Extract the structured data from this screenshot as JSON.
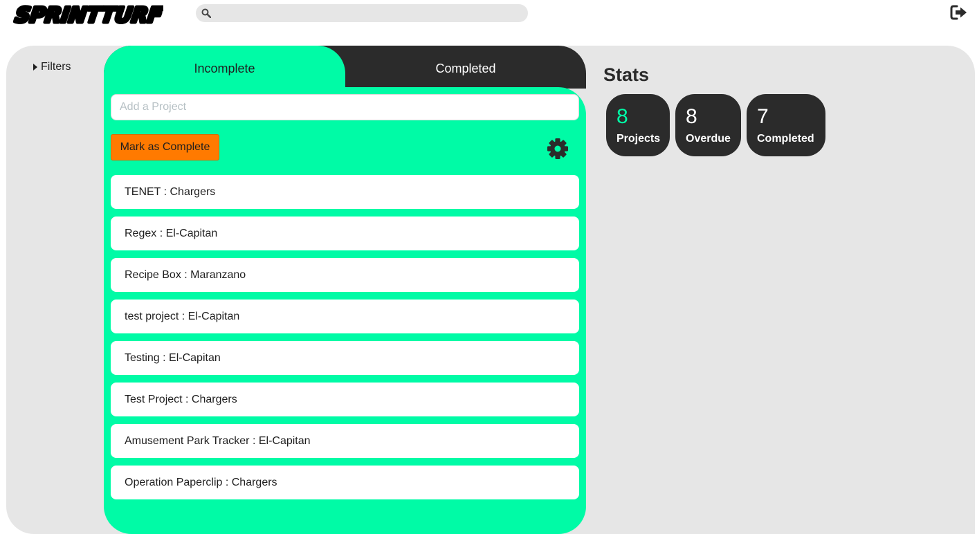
{
  "app": {
    "logo_text": "SPRINTTURF"
  },
  "search": {
    "placeholder": "",
    "value": ""
  },
  "filters": {
    "label": "Filters"
  },
  "tabs": [
    {
      "label": "Incomplete",
      "active": true
    },
    {
      "label": "Completed",
      "active": false
    }
  ],
  "project_form": {
    "placeholder": "Add a Project",
    "mark_complete_label": "Mark as Complete"
  },
  "projects": [
    {
      "label": "TENET : Chargers"
    },
    {
      "label": "Regex : El-Capitan"
    },
    {
      "label": "Recipe Box : Maranzano"
    },
    {
      "label": "test project : El-Capitan"
    },
    {
      "label": "Testing : El-Capitan"
    },
    {
      "label": "Test Project : Chargers"
    },
    {
      "label": "Amusement Park Tracker : El-Capitan"
    },
    {
      "label": "Operation Paperclip : Chargers"
    }
  ],
  "stats": {
    "title": "Stats",
    "cards": [
      {
        "value": "8",
        "label": "Projects",
        "value_color": "#00fba6"
      },
      {
        "value": "8",
        "label": "Overdue",
        "value_color": "#ffffff"
      },
      {
        "value": "7",
        "label": "Completed",
        "value_color": "#ffffff"
      }
    ]
  },
  "colors": {
    "accent": "#00fba6",
    "dark": "#2b2b2b",
    "button": "#ff7a00",
    "panel": "#e6e6e6"
  },
  "icons": {
    "search": "search-icon",
    "logout": "logout-icon",
    "settings": "gear-icon",
    "filters": "caret-right-icon"
  }
}
